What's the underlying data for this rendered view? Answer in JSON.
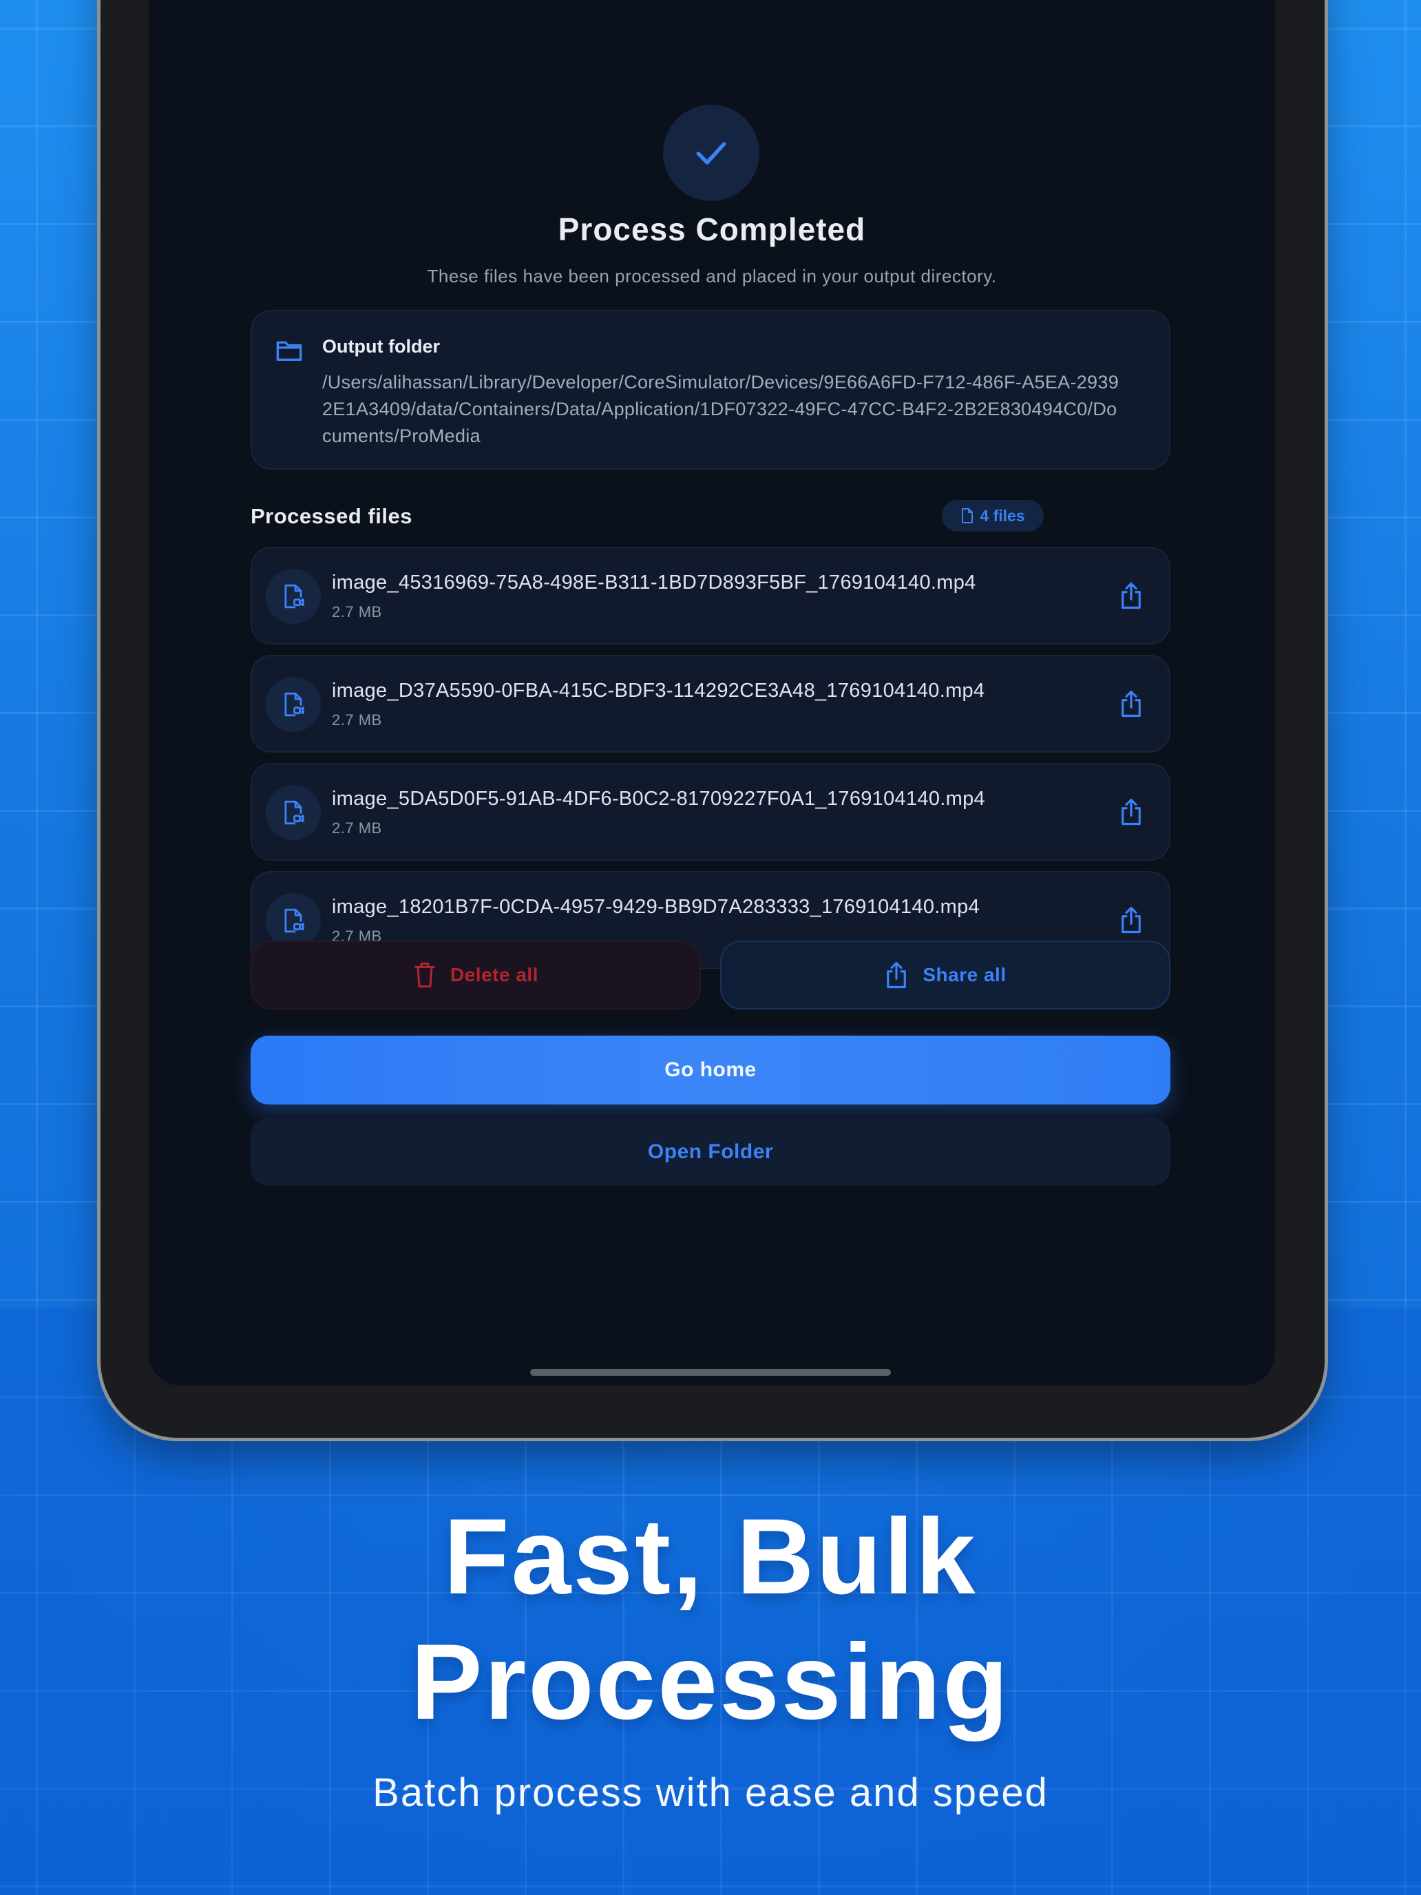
{
  "screen": {
    "title": "Process Completed",
    "subtitle": "These files have been processed and placed in your output directory.",
    "output": {
      "label": "Output folder",
      "path": "/Users/alihassan/Library/Developer/CoreSimulator/Devices/9E66A6FD-F712-486F-A5EA-29392E1A3409/data/Containers/Data/Application/1DF07322-49FC-47CC-B4F2-2B2E830494C0/Documents/ProMedia"
    },
    "processed": {
      "label": "Processed files",
      "count_badge": "4 files",
      "files": [
        {
          "name": "image_45316969-75A8-498E-B311-1BD7D893F5BF_1769104140.mp4",
          "size": "2.7 MB"
        },
        {
          "name": "image_D37A5590-0FBA-415C-BDF3-114292CE3A48_1769104140.mp4",
          "size": "2.7 MB"
        },
        {
          "name": "image_5DA5D0F5-91AB-4DF6-B0C2-81709227F0A1_1769104140.mp4",
          "size": "2.7 MB"
        },
        {
          "name": "image_18201B7F-0CDA-4957-9429-BB9D7A283333_1769104140.mp4",
          "size": "2.7 MB"
        }
      ]
    },
    "actions": {
      "delete_all": "Delete all",
      "share_all": "Share all",
      "go_home": "Go home",
      "open_folder": "Open Folder"
    }
  },
  "marketing": {
    "headline_line1": "Fast, Bulk",
    "headline_line2": "Processing",
    "tagline": "Batch process with ease and speed"
  },
  "colors": {
    "background_blue": "#1577e0",
    "screen_bg": "#0b111b",
    "accent": "#3b82f6",
    "danger": "#b3242f"
  },
  "icons": [
    "checkmark-icon",
    "folder-icon",
    "file-icon",
    "video-file-icon",
    "share-icon",
    "trash-icon"
  ]
}
